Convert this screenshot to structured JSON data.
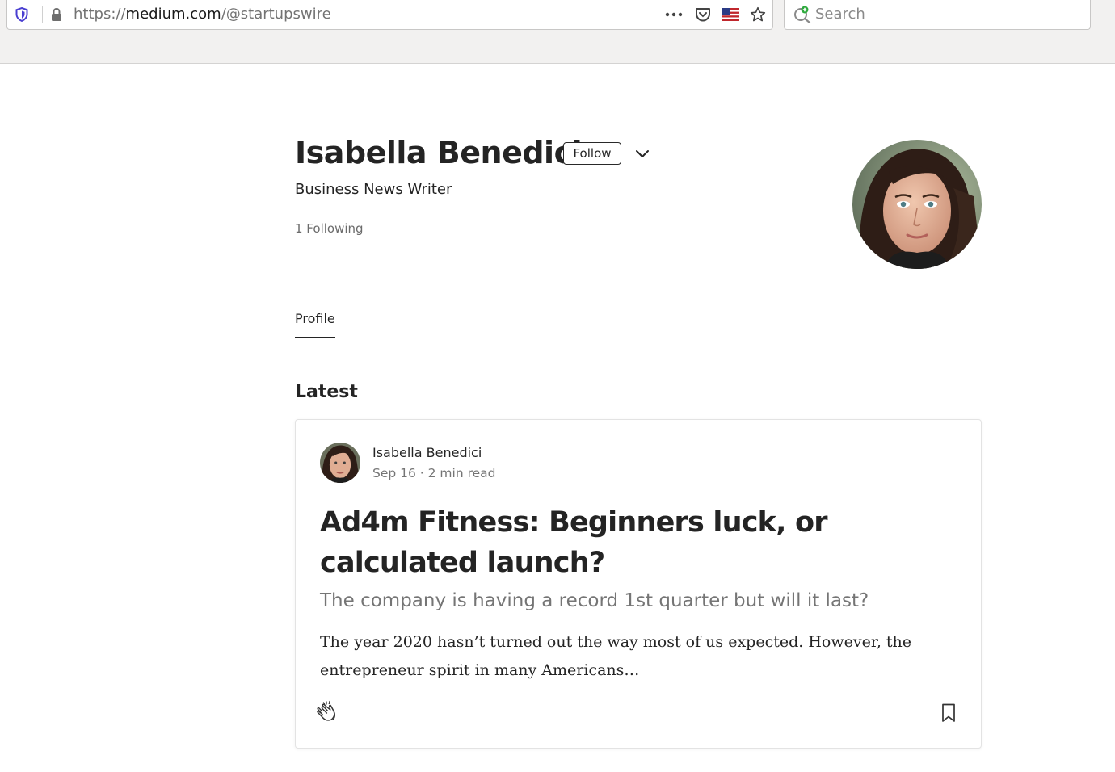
{
  "browser": {
    "url_scheme": "https://",
    "url_host": "medium.com",
    "url_path": "/@startupswire",
    "search_placeholder": "Search",
    "icons": [
      "shield-icon",
      "lock-icon",
      "page-actions-icon",
      "pocket-icon",
      "us-flag-icon",
      "bookmark-star-icon",
      "search-icon"
    ]
  },
  "profile": {
    "name": "Isabella Benedici",
    "follow_label": "Follow",
    "bio": "Business News Writer",
    "following": "1 Following"
  },
  "tabs": [
    {
      "label": "Profile",
      "active": true
    }
  ],
  "section": {
    "latest_label": "Latest"
  },
  "post": {
    "author": "Isabella Benedici",
    "date_read": "Sep 16 · 2 min read",
    "title": "Ad4m Fitness: Beginners luck, or calculated launch?",
    "subtitle": "The company is having a record 1st quarter but will it last?",
    "excerpt": "The year 2020 hasn’t turned out the way most of us expected. However, the entrepreneur spirit in many Americans…"
  },
  "colors": {
    "text": "#242424",
    "muted": "#757575",
    "chrome_bg": "#f2f1f0",
    "border": "#e6e6e6"
  }
}
